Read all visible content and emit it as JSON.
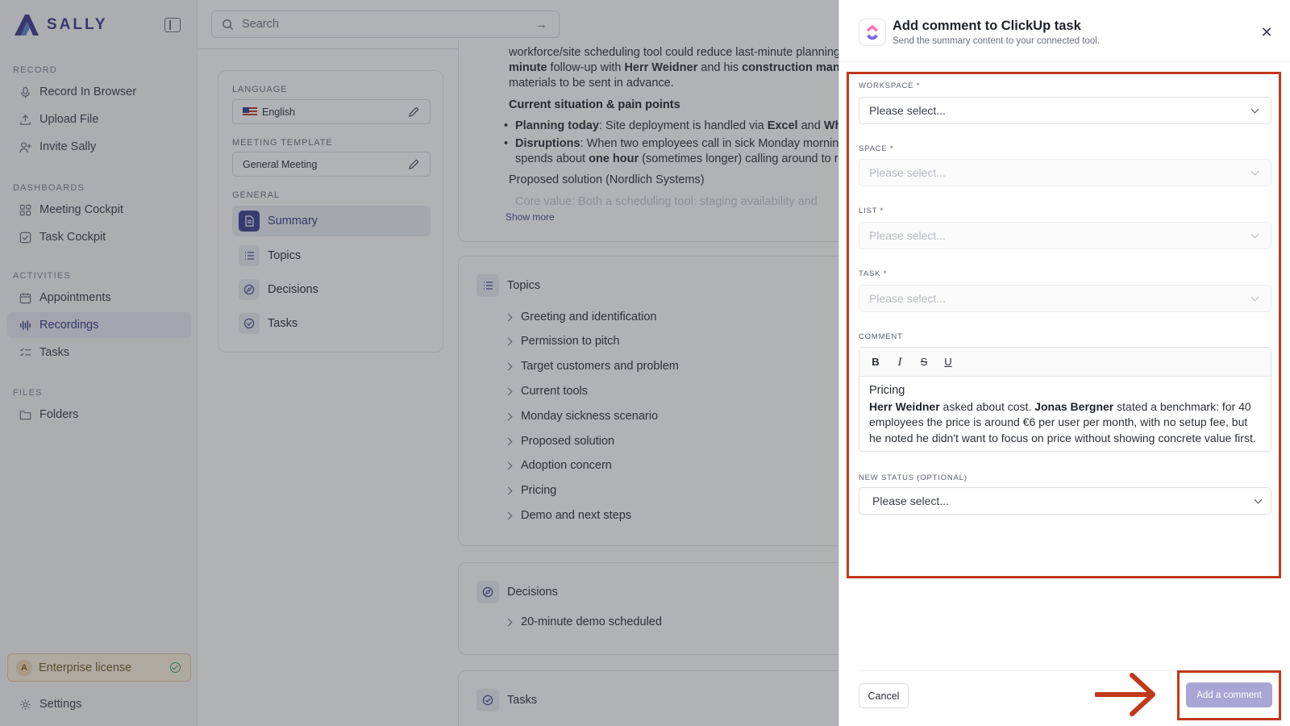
{
  "app": {
    "name": "SALLY"
  },
  "colors": {
    "accent": "#3d3b8e",
    "highlight": "#c0391c",
    "primary_button": "#a9a5d4"
  },
  "sidebar": {
    "sections": [
      {
        "label": "RECORD",
        "items": [
          {
            "label": "Record In Browser",
            "icon": "microphone-icon"
          },
          {
            "label": "Upload File",
            "icon": "upload-icon"
          },
          {
            "label": "Invite Sally",
            "icon": "user-plus-icon"
          }
        ]
      },
      {
        "label": "DASHBOARDS",
        "items": [
          {
            "label": "Meeting Cockpit",
            "icon": "grid-icon"
          },
          {
            "label": "Task Cockpit",
            "icon": "checkbox-icon"
          }
        ]
      },
      {
        "label": "ACTIVITIES",
        "items": [
          {
            "label": "Appointments",
            "icon": "calendar-icon"
          },
          {
            "label": "Recordings",
            "icon": "waveform-icon",
            "active": true
          },
          {
            "label": "Tasks",
            "icon": "checklist-icon"
          }
        ]
      },
      {
        "label": "FILES",
        "items": [
          {
            "label": "Folders",
            "icon": "folder-icon"
          }
        ]
      }
    ],
    "license": "Enterprise license",
    "settings": "Settings"
  },
  "search": {
    "placeholder": "Search"
  },
  "settings_card": {
    "language_label": "LANGUAGE",
    "language_value": "English",
    "template_label": "MEETING TEMPLATE",
    "template_value": "General Meeting",
    "general_label": "GENERAL",
    "items": [
      {
        "label": "Summary",
        "active": true
      },
      {
        "label": "Topics"
      },
      {
        "label": "Decisions"
      },
      {
        "label": "Tasks"
      }
    ]
  },
  "summary": {
    "line1": "workforce/site scheduling tool could reduce last-minute planning e",
    "line2_bold": "minute",
    "line2_rest": " follow-up with ",
    "line2_name": "Herr Weidner",
    "line2_and": " and his ",
    "line2_team": "construction manage",
    "line3": "materials to be sent in advance.",
    "heading": "Current situation & pain points",
    "bullet1_label": "Planning today",
    "bullet1_text": ": Site deployment is handled via ",
    "bullet1_excel": "Excel",
    "bullet1_and": " and ",
    "bullet1_what": "What",
    "bullet2_label": "Disruptions",
    "bullet2_text": ": When two employees call in sick Monday morning,",
    "bullet2_cont1": "spends about ",
    "bullet2_hour": "one hour",
    "bullet2_cont2": " (sometimes longer) calling around to re",
    "proposed": "Proposed solution (Nordlich Systems)",
    "cut_line": "Core value: Both a scheduling tool: staging availability and",
    "show_more": "Show more"
  },
  "topics": {
    "title": "Topics",
    "items": [
      "Greeting and identification",
      "Permission to pitch",
      "Target customers and problem",
      "Current tools",
      "Monday sickness scenario",
      "Proposed solution",
      "Adoption concern",
      "Pricing",
      "Demo and next steps"
    ]
  },
  "decisions": {
    "title": "Decisions",
    "items": [
      "20-minute demo scheduled"
    ]
  },
  "tasks": {
    "title": "Tasks"
  },
  "modal": {
    "title": "Add comment to ClickUp task",
    "subtitle": "Send the summary content to your connected tool.",
    "fields": {
      "workspace": {
        "label": "WORKSPACE *",
        "value": "Please select..."
      },
      "space": {
        "label": "SPACE *",
        "value": "Please select..."
      },
      "list": {
        "label": "LIST *",
        "value": "Please select..."
      },
      "task": {
        "label": "TASK *",
        "value": "Please select..."
      },
      "comment": {
        "label": "COMMENT"
      },
      "status": {
        "label": "NEW STATUS (OPTIONAL)",
        "value": "Please select..."
      }
    },
    "toolbar": [
      "B",
      "I",
      "S",
      "U"
    ],
    "comment_body": {
      "title": "Pricing",
      "name1": "Herr Weidner",
      "text1": " asked about cost. ",
      "name2": "Jonas Bergner",
      "text2": " stated a benchmark: for 40 employees the price is around €6 per user per month, with no setup fee, but he noted he didn't want to focus on price without showing concrete value first."
    },
    "cancel": "Cancel",
    "submit": "Add a comment"
  }
}
